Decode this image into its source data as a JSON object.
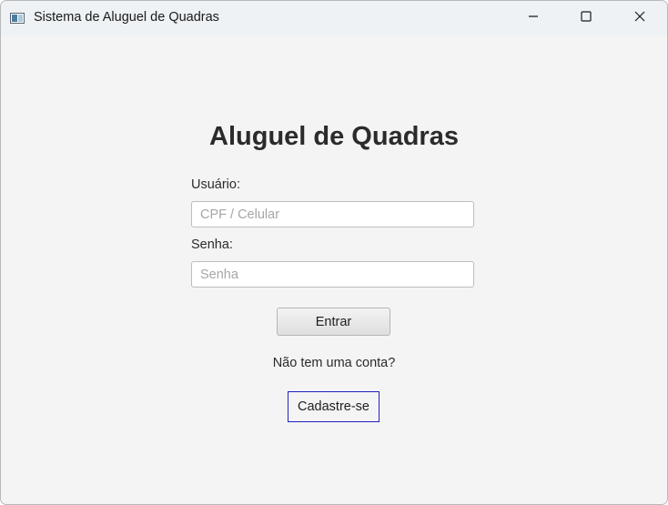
{
  "window": {
    "title": "Sistema de Aluguel de Quadras",
    "controls": {
      "minimize_icon": "minimize-icon",
      "maximize_icon": "maximize-icon",
      "close_icon": "close-icon"
    }
  },
  "login": {
    "heading": "Aluguel de Quadras",
    "user_label": "Usuário:",
    "user_value": "",
    "user_placeholder": "CPF / Celular",
    "password_label": "Senha:",
    "password_value": "",
    "password_placeholder": "Senha",
    "submit_label": "Entrar",
    "no_account_text": "Não tem uma conta?",
    "signup_label": "Cadastre-se"
  },
  "colors": {
    "window_background": "#f4f4f4",
    "titlebar_background": "#eef2f5",
    "focus_border": "#2020c0",
    "text": "#2b2b2b",
    "placeholder": "#a6a6a6"
  }
}
